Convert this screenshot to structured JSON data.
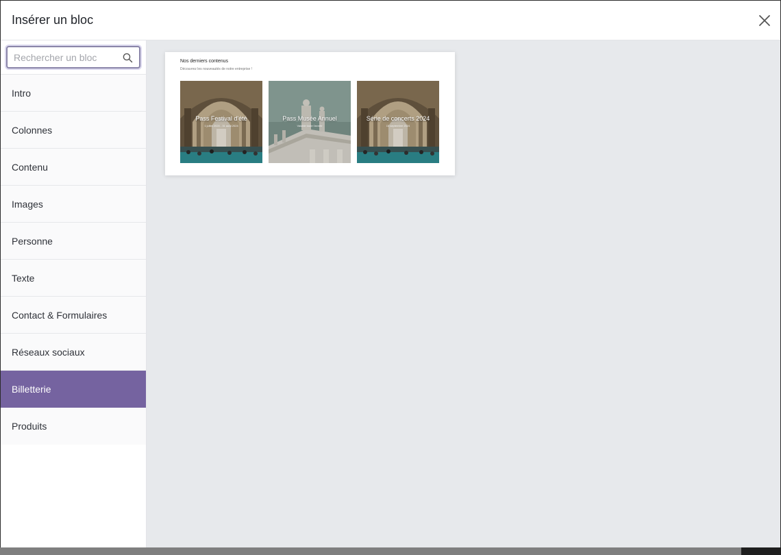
{
  "modal": {
    "title": "Insérer un bloc",
    "close_icon": "close-icon"
  },
  "search": {
    "placeholder": "Rechercher un bloc",
    "value": "",
    "icon": "search-icon"
  },
  "sidebar": {
    "items": [
      {
        "label": "Intro",
        "active": false
      },
      {
        "label": "Colonnes",
        "active": false
      },
      {
        "label": "Contenu",
        "active": false
      },
      {
        "label": "Images",
        "active": false
      },
      {
        "label": "Personne",
        "active": false
      },
      {
        "label": "Texte",
        "active": false
      },
      {
        "label": "Contact & Formulaires",
        "active": false
      },
      {
        "label": "Réseaux sociaux",
        "active": false
      },
      {
        "label": "Billetterie",
        "active": true
      },
      {
        "label": "Produits",
        "active": false
      }
    ]
  },
  "preview": {
    "title": "Nos derniers contenus",
    "subtitle": "Découvrez les nouveautés de notre entreprise !",
    "tiles": [
      {
        "label": "Pass Festival d'été",
        "date": "1 juillet 2024 - 31 août 2024",
        "image": "museum-hall"
      },
      {
        "label": "Pass Musée Annuel",
        "date": "Valable toute l'année",
        "image": "statue-roof"
      },
      {
        "label": "Série de concerts 2024",
        "date": "15 septembre 2024",
        "image": "museum-hall"
      }
    ]
  },
  "colors": {
    "accent": "#7563a0",
    "preview_bg": "#e7e9ec",
    "search_border": "#8a85a9"
  }
}
